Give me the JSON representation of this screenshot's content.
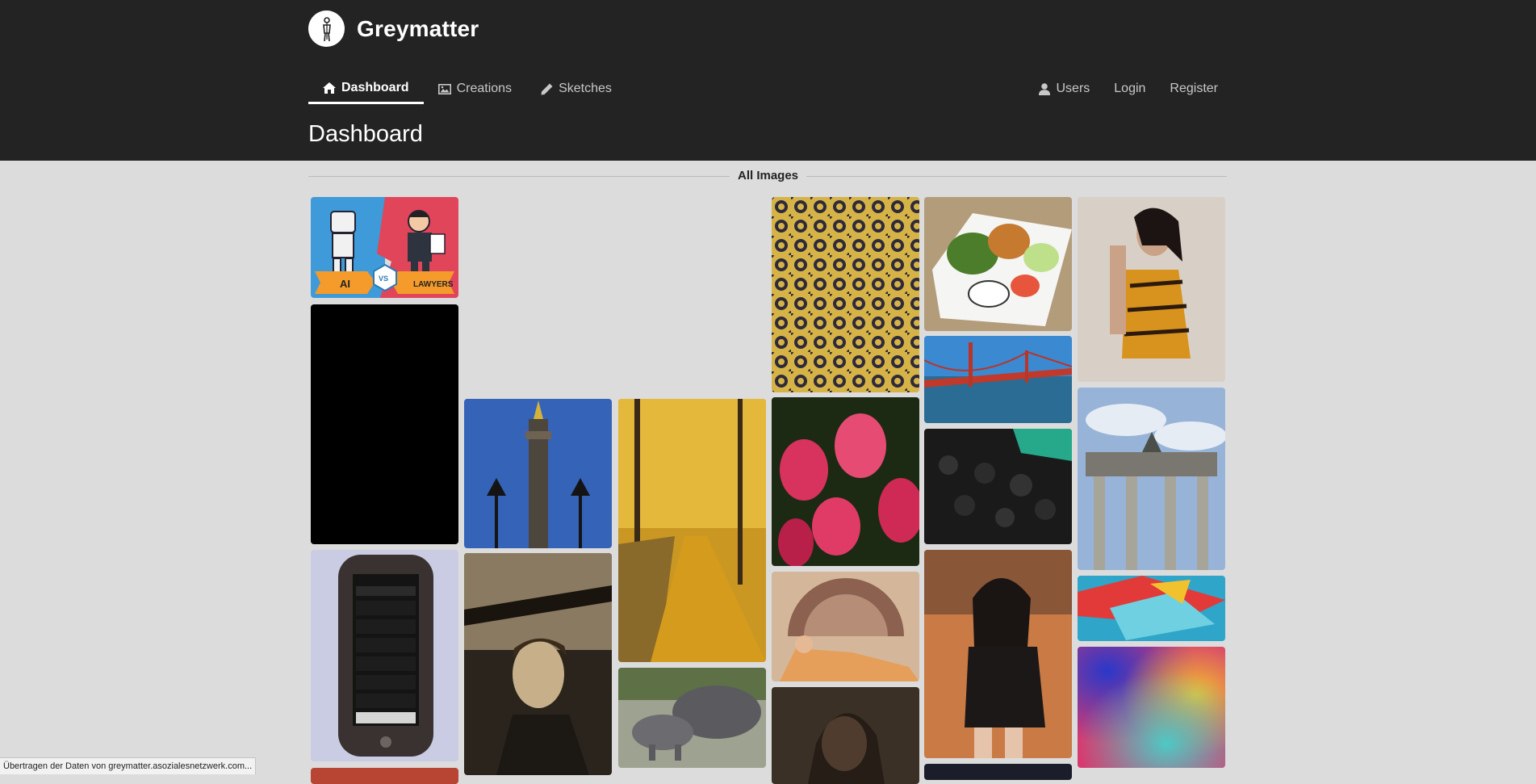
{
  "app": {
    "name": "Greymatter",
    "logo_icon": "pencil-person-logo"
  },
  "nav": {
    "left": [
      {
        "label": "Dashboard",
        "icon": "home-icon",
        "active": true
      },
      {
        "label": "Creations",
        "icon": "image-icon",
        "active": false
      },
      {
        "label": "Sketches",
        "icon": "pencil-icon",
        "active": false
      }
    ],
    "right": [
      {
        "label": "Users",
        "icon": "user-icon"
      },
      {
        "label": "Login"
      },
      {
        "label": "Register"
      }
    ]
  },
  "page": {
    "title": "Dashboard",
    "section_label": "All Images"
  },
  "images": {
    "ai_vs_lawyers": {
      "left_text": "AI",
      "middle_text": "VS",
      "right_text": "LAWYERS"
    }
  },
  "status_bar": {
    "text": "Übertragen der Daten von greymatter.asozialesnetzwerk.com..."
  },
  "colors": {
    "header_bg": "#232323",
    "page_bg": "#dcdcdc",
    "active_underline": "#ffffff"
  }
}
